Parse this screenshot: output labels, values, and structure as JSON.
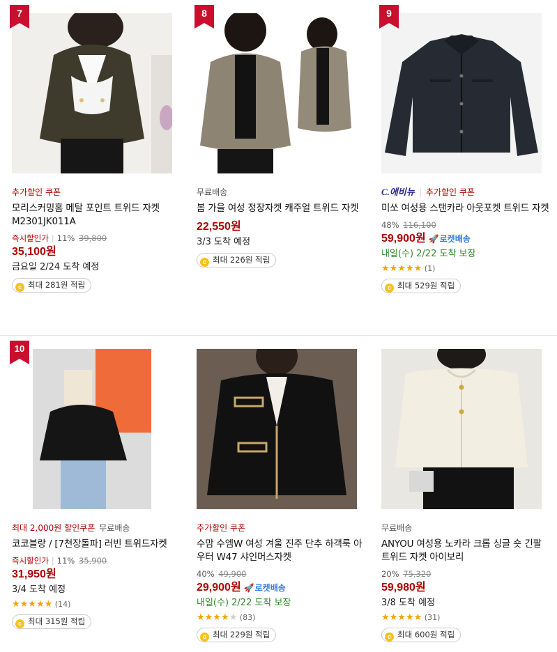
{
  "colors": {
    "accent_red": "#ae0000",
    "rocket_blue": "#2f7de1",
    "delivery_green": "#2f8a28",
    "star": "#f5a200",
    "coin": "#f8c21c"
  },
  "icons": {
    "rank": "rank-flag-icon",
    "coin": "coin-icon",
    "rocket": "rocket-icon",
    "star": "star-icon"
  },
  "products": [
    {
      "rank": "7",
      "badge_red": "추가할인 쿠폰",
      "badge_gray": "",
      "brand": "",
      "title": "모리스커밍홈 메탈 포인트 트위드 자켓 M2301JK011A",
      "discount_label": "즉시할인가",
      "discount_percent": "11%",
      "original_price": "39,800",
      "price": "35,100원",
      "rocket": "",
      "delivery": "금요일 2/24 도착 예정",
      "delivery_green": false,
      "rating": 0,
      "review_count": "",
      "points": "최대 281원 적립",
      "coin_symbol": "c"
    },
    {
      "rank": "8",
      "badge_red": "",
      "badge_gray": "무료배송",
      "brand": "",
      "title": "봄 가을 여성 정장자켓 캐주얼 트위드 자켓",
      "discount_label": "",
      "discount_percent": "",
      "original_price": "",
      "price": "22,550원",
      "rocket": "",
      "delivery": "3/3 도착 예정",
      "delivery_green": false,
      "rating": 0,
      "review_count": "",
      "points": "최대 226원 적립",
      "coin_symbol": "c"
    },
    {
      "rank": "9",
      "badge_red": "추가할인 쿠폰",
      "badge_gray": "",
      "brand": "C.에비뉴",
      "title": "미쏘 여성용 스탠카라 아웃포켓 트위드 자켓",
      "discount_label": "",
      "discount_percent": "48%",
      "original_price": "116,100",
      "price": "59,900원",
      "rocket": "로켓배송",
      "delivery": "내일(수) 2/22 도착 보장",
      "delivery_green": true,
      "rating": 5,
      "review_count": "(1)",
      "points": "최대 529원 적립",
      "coin_symbol": "c"
    },
    {
      "rank": "10",
      "badge_red": "최대 2,000원 할인쿠폰",
      "badge_gray": "무료배송",
      "brand": "",
      "title": "코코블랑 / [7천장돌파] 러빈 트위드자켓",
      "discount_label": "즉시할인가",
      "discount_percent": "11%",
      "original_price": "35,900",
      "price": "31,950원",
      "rocket": "",
      "delivery": "3/4 도착 예정",
      "delivery_green": false,
      "rating": 5,
      "review_count": "(14)",
      "points": "최대 315원 적립",
      "coin_symbol": "c"
    },
    {
      "rank": "",
      "badge_red": "추가할인 쿠폰",
      "badge_gray": "",
      "brand": "",
      "title": "수맘 수엠W 여성 겨울 진주 단추 하객룩 아우터 W47 샤인머스자켓",
      "discount_label": "",
      "discount_percent": "40%",
      "original_price": "49,900",
      "price": "29,900원",
      "rocket": "로켓배송",
      "delivery": "내일(수) 2/22 도착 보장",
      "delivery_green": true,
      "rating": 4.5,
      "review_count": "(83)",
      "points": "최대 229원 적립",
      "coin_symbol": "c"
    },
    {
      "rank": "",
      "badge_red": "",
      "badge_gray": "무료배송",
      "brand": "",
      "title": "ANYOU 여성용 노카라 크롭 싱글 숏 긴팔 트위드 자켓 아이보리",
      "discount_label": "",
      "discount_percent": "20%",
      "original_price": "75,320",
      "price": "59,980원",
      "rocket": "",
      "delivery": "3/8 도착 예정",
      "delivery_green": false,
      "rating": 5,
      "review_count": "(31)",
      "points": "최대 600원 적립",
      "coin_symbol": "c"
    }
  ]
}
